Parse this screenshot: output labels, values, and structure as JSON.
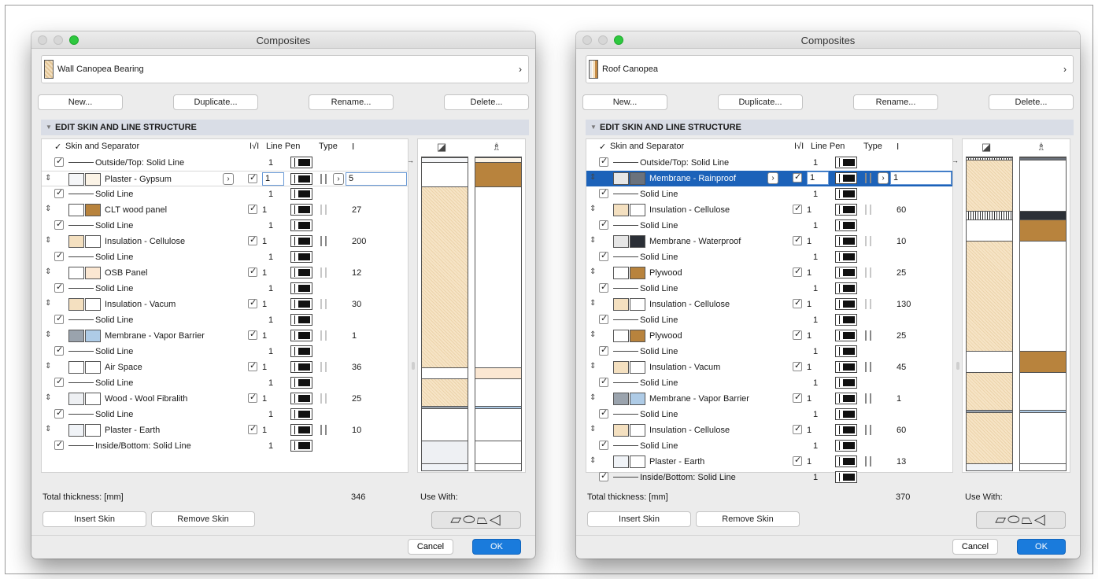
{
  "colors": {
    "accent": "#1a7bdc",
    "selection": "#1c62b9",
    "gypsum": "#fbf3e6",
    "wood": "#b8833d",
    "cellulose": "#f4e0c0",
    "vapor_gray": "#9aa3ad",
    "vapor_blue": "#aecbe6",
    "membrane_dark": "#2b2f36"
  },
  "icons": [
    "window-close-icon",
    "window-minimize-icon",
    "window-zoom-icon",
    "chevron-right-icon",
    "drag-handle-icon",
    "checkbox-icon",
    "line-pen-icon",
    "skin-type-icon",
    "thickness-icon",
    "cut-fill-icon",
    "cover-fill-icon",
    "use-with-wall-icon",
    "use-with-slab-icon",
    "use-with-roof-icon",
    "use-with-shell-icon"
  ],
  "windows": [
    {
      "title": "Composites",
      "composite_name": "Wall Canopea Bearing",
      "buttons": {
        "new": "New...",
        "duplicate": "Duplicate...",
        "rename": "Rename...",
        "delete": "Delete..."
      },
      "section": "EDIT SKIN AND LINE STRUCTURE",
      "headers": {
        "skin": "Skin and Separator",
        "check": "I√I",
        "line_pen": "Line Pen",
        "type": "Type",
        "thickness": "Ⅰ"
      },
      "rows": [
        {
          "kind": "sep",
          "name": "Outside/Top: Solid Line",
          "line": "1"
        },
        {
          "kind": "skin",
          "name": "Plaster - Gypsum",
          "line": "1",
          "thick": "5",
          "sw1": "#f5f6f8",
          "sw2": "#fbf3e6",
          "type": "dk",
          "editing": true
        },
        {
          "kind": "sep",
          "name": "Solid Line",
          "line": "1"
        },
        {
          "kind": "skin",
          "name": "CLT wood panel",
          "line": "1",
          "thick": "27",
          "sw1": "#fff",
          "sw2": "#b8833d",
          "type": "lt"
        },
        {
          "kind": "sep",
          "name": "Solid Line",
          "line": "1"
        },
        {
          "kind": "skin",
          "name": "Insulation - Cellulose",
          "line": "1",
          "thick": "200",
          "sw1": "#f4e0c0",
          "sw2": "#fff",
          "type": "dk"
        },
        {
          "kind": "sep",
          "name": "Solid Line",
          "line": "1"
        },
        {
          "kind": "skin",
          "name": "OSB Panel",
          "line": "1",
          "thick": "12",
          "sw1": "#fff",
          "sw2": "#fbe7d2",
          "type": "lt"
        },
        {
          "kind": "sep",
          "name": "Solid Line",
          "line": "1"
        },
        {
          "kind": "skin",
          "name": "Insulation - Vacum",
          "line": "1",
          "thick": "30",
          "sw1": "#f4e0c0",
          "sw2": "#fff",
          "type": "lt"
        },
        {
          "kind": "sep",
          "name": "Solid Line",
          "line": "1"
        },
        {
          "kind": "skin",
          "name": "Membrane - Vapor Barrier",
          "line": "1",
          "thick": "1",
          "sw1": "#9aa3ad",
          "sw2": "#aecbe6",
          "type": "lt"
        },
        {
          "kind": "sep",
          "name": "Solid Line",
          "line": "1"
        },
        {
          "kind": "skin",
          "name": "Air Space",
          "line": "1",
          "thick": "36",
          "sw1": "#fff",
          "sw2": "#fff",
          "type": "lt"
        },
        {
          "kind": "sep",
          "name": "Solid Line",
          "line": "1"
        },
        {
          "kind": "skin",
          "name": "Wood - Wool Fibralith",
          "line": "1",
          "thick": "25",
          "sw1": "#eef0f3",
          "sw2": "#fff",
          "type": "lt"
        },
        {
          "kind": "sep",
          "name": "Solid Line",
          "line": "1"
        },
        {
          "kind": "skin",
          "name": "Plaster - Earth",
          "line": "1",
          "thick": "10",
          "sw1": "#f0f3f7",
          "sw2": "#fff",
          "type": "dk"
        },
        {
          "kind": "sep",
          "name": "Inside/Bottom: Solid Line",
          "line": "1"
        }
      ],
      "total_label": "Total thickness: [mm]",
      "total_value": "346",
      "use_with": "Use With:",
      "insert_skin": "Insert Skin",
      "remove_skin": "Remove Skin",
      "cancel": "Cancel",
      "ok": "OK"
    },
    {
      "title": "Composites",
      "composite_name": "Roof Canopea",
      "buttons": {
        "new": "New...",
        "duplicate": "Duplicate...",
        "rename": "Rename...",
        "delete": "Delete..."
      },
      "section": "EDIT SKIN AND LINE STRUCTURE",
      "headers": {
        "skin": "Skin and Separator",
        "check": "I√I",
        "line_pen": "Line Pen",
        "type": "Type",
        "thickness": "Ⅰ"
      },
      "rows": [
        {
          "kind": "sep",
          "name": "Outside/Top: Solid Line",
          "line": "1"
        },
        {
          "kind": "skin",
          "name": "Membrane - Rainproof",
          "line": "1",
          "thick": "1",
          "sw1": "#e6e6e6",
          "sw2": "#6b727c",
          "type": "dk",
          "highlight": true
        },
        {
          "kind": "sep",
          "name": "Solid Line",
          "line": "1"
        },
        {
          "kind": "skin",
          "name": "Insulation - Cellulose",
          "line": "1",
          "thick": "60",
          "sw1": "#f4e0c0",
          "sw2": "#fff",
          "type": "lt"
        },
        {
          "kind": "sep",
          "name": "Solid Line",
          "line": "1"
        },
        {
          "kind": "skin",
          "name": "Membrane - Waterproof",
          "line": "1",
          "thick": "10",
          "sw1": "#e6e6e6",
          "sw2": "#2b2f36",
          "type": "lt"
        },
        {
          "kind": "sep",
          "name": "Solid Line",
          "line": "1"
        },
        {
          "kind": "skin",
          "name": "Plywood",
          "line": "1",
          "thick": "25",
          "sw1": "#fff",
          "sw2": "#b8833d",
          "type": "lt"
        },
        {
          "kind": "sep",
          "name": "Solid Line",
          "line": "1"
        },
        {
          "kind": "skin",
          "name": "Insulation - Cellulose",
          "line": "1",
          "thick": "130",
          "sw1": "#f4e0c0",
          "sw2": "#fff",
          "type": "lt"
        },
        {
          "kind": "sep",
          "name": "Solid Line",
          "line": "1"
        },
        {
          "kind": "skin",
          "name": "Plywood",
          "line": "1",
          "thick": "25",
          "sw1": "#fff",
          "sw2": "#b8833d",
          "type": "dk"
        },
        {
          "kind": "sep",
          "name": "Solid Line",
          "line": "1"
        },
        {
          "kind": "skin",
          "name": "Insulation - Vacum",
          "line": "1",
          "thick": "45",
          "sw1": "#f4e0c0",
          "sw2": "#fff",
          "type": "dk"
        },
        {
          "kind": "sep",
          "name": "Solid Line",
          "line": "1"
        },
        {
          "kind": "skin",
          "name": "Membrane - Vapor Barrier",
          "line": "1",
          "thick": "1",
          "sw1": "#9aa3ad",
          "sw2": "#aecbe6",
          "type": "dk"
        },
        {
          "kind": "sep",
          "name": "Solid Line",
          "line": "1"
        },
        {
          "kind": "skin",
          "name": "Insulation - Cellulose",
          "line": "1",
          "thick": "60",
          "sw1": "#f4e0c0",
          "sw2": "#fff",
          "type": "dk"
        },
        {
          "kind": "sep",
          "name": "Solid Line",
          "line": "1"
        },
        {
          "kind": "skin",
          "name": "Plaster - Earth",
          "line": "1",
          "thick": "13",
          "sw1": "#f0f3f7",
          "sw2": "#fff",
          "type": "dk"
        },
        {
          "kind": "sep",
          "name": "Inside/Bottom: Solid Line",
          "line": "1"
        }
      ],
      "total_label": "Total thickness: [mm]",
      "total_value": "370",
      "use_with": "Use With:",
      "insert_skin": "Insert Skin",
      "remove_skin": "Remove Skin",
      "cancel": "Cancel",
      "ok": "OK"
    }
  ]
}
